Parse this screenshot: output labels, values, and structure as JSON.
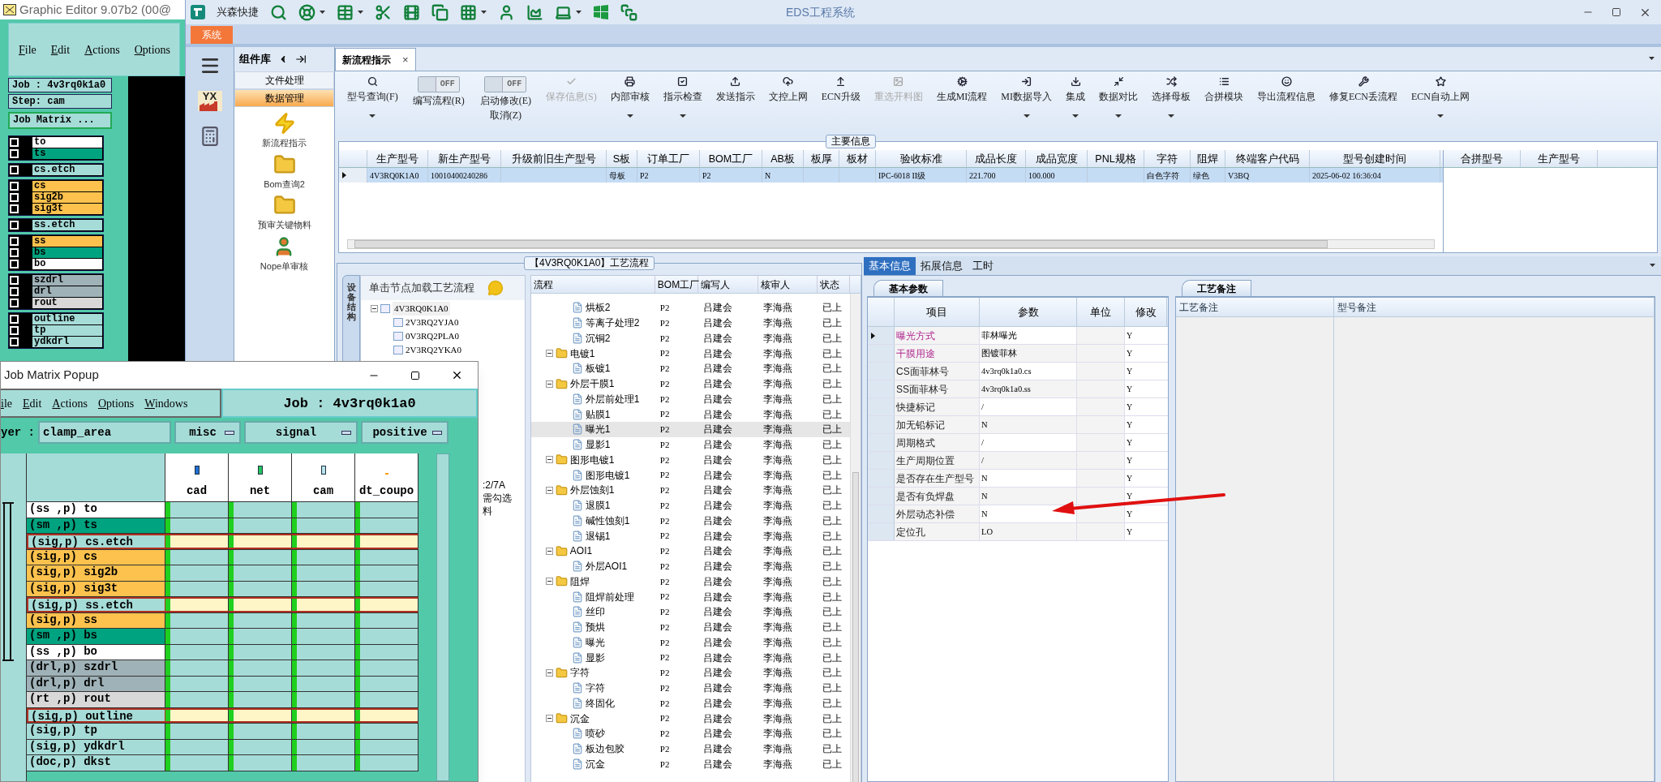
{
  "graphic_editor": {
    "title": "Graphic Editor 9.07b2 (00@",
    "menu": [
      "File",
      "Edit",
      "Actions",
      "Options"
    ],
    "job": "Job : 4v3rq0k1a0",
    "step": "Step: cam",
    "matrix_button": "Job Matrix ...",
    "layer_groups": [
      {
        "layers": [
          {
            "name": "to",
            "color": "#ffffff",
            "checked": false
          },
          {
            "name": "ts",
            "color": "#00a37f",
            "checked": false
          }
        ]
      },
      {
        "layers": [
          {
            "name": "cs.etch",
            "color": "#a6dcd8",
            "checked": false
          }
        ]
      },
      {
        "layers": [
          {
            "name": "cs",
            "color": "#fcc24d",
            "checked": false
          },
          {
            "name": "sig2b",
            "color": "#fcc24d",
            "checked": false
          },
          {
            "name": "sig3t",
            "color": "#fcc24d",
            "checked": false
          }
        ]
      },
      {
        "layers": [
          {
            "name": "ss.etch",
            "color": "#a6dcd8",
            "checked": false
          }
        ]
      },
      {
        "layers": [
          {
            "name": "ss",
            "color": "#fcc24d",
            "checked": false
          },
          {
            "name": "bs",
            "color": "#00a37f",
            "checked": false
          },
          {
            "name": "bo",
            "color": "#ffffff",
            "checked": false
          }
        ]
      },
      {
        "layers": [
          {
            "name": "szdrl",
            "color": "#9fb2b8",
            "checked": false
          },
          {
            "name": "drl",
            "color": "#9fb2b8",
            "checked": false
          },
          {
            "name": "rout",
            "color": "#d8d8d8",
            "checked": false
          }
        ]
      },
      {
        "layers": [
          {
            "name": "outline",
            "color": "#a6dcd8",
            "checked": false
          },
          {
            "name": "tp",
            "color": "#a6dcd8",
            "checked": false
          },
          {
            "name": "ydkdrl",
            "color": "#a6dcd8",
            "checked": false
          }
        ]
      }
    ]
  },
  "eds": {
    "brand": "兴森快捷",
    "title": "EDS工程系统",
    "side_logo": "YX",
    "ribbon_tabs": [
      {
        "label": "系统",
        "selected": true
      }
    ],
    "component_library": {
      "title": "组件库",
      "categories": [
        {
          "label": "文件处理",
          "selected": false
        },
        {
          "label": "数据管理",
          "selected": true
        }
      ],
      "items": [
        "新流程指示",
        "Bom查询2",
        "预审关键物料",
        "Nope单审核"
      ]
    },
    "doc_tabs": [
      {
        "label": "新流程指示",
        "selected": true,
        "close": "×"
      }
    ],
    "toolbar": [
      {
        "kind": "button",
        "label": "型号查询(F)",
        "disabled": false,
        "dropdown": true
      },
      {
        "kind": "switch",
        "label": "编写流程(R)",
        "switch_text": "OFF",
        "on": false
      },
      {
        "kind": "switch",
        "label": "启动修改(E)",
        "label2": "取消(Z)",
        "switch_text": "OFF",
        "on": false
      },
      {
        "kind": "button",
        "label": "保存信息(S)",
        "disabled": true,
        "dropdown": false
      },
      {
        "kind": "button",
        "label": "内部审核",
        "disabled": false,
        "dropdown": true
      },
      {
        "kind": "button",
        "label": "指示检查",
        "disabled": false,
        "dropdown": true
      },
      {
        "kind": "button",
        "label": "发送指示",
        "disabled": false,
        "dropdown": false
      },
      {
        "kind": "button",
        "label": "文控上网",
        "disabled": false,
        "dropdown": false
      },
      {
        "kind": "button",
        "label": "ECN升级",
        "disabled": false,
        "dropdown": false
      },
      {
        "kind": "button",
        "label": "重选开料图",
        "disabled": true,
        "dropdown": false
      },
      {
        "kind": "button",
        "label": "生成MI流程",
        "disabled": false,
        "dropdown": false
      },
      {
        "kind": "button",
        "label": "MI数据导入",
        "disabled": false,
        "dropdown": true
      },
      {
        "kind": "button",
        "label": "集成",
        "disabled": false,
        "dropdown": true
      },
      {
        "kind": "button",
        "label": "数据对比",
        "disabled": false,
        "dropdown": true
      },
      {
        "kind": "button",
        "label": "选择母板",
        "disabled": false,
        "dropdown": true
      },
      {
        "kind": "button",
        "label": "合拼模块",
        "disabled": false,
        "dropdown": false
      },
      {
        "kind": "button",
        "label": "导出流程信息",
        "disabled": false,
        "dropdown": false
      },
      {
        "kind": "button",
        "label": "修复ECN丢流程",
        "disabled": false,
        "dropdown": false
      },
      {
        "kind": "button",
        "label": "ECN自动上网",
        "disabled": false,
        "dropdown": true
      }
    ],
    "main_info": {
      "title": "主要信息",
      "columns": [
        "生产型号",
        "新生产型号",
        "升级前旧生产型号",
        "S板",
        "订单工厂",
        "BOM工厂",
        "AB板",
        "板厚",
        "板材",
        "验收标准",
        "成品长度",
        "成品宽度",
        "PNL规格",
        "字符",
        "阻焊",
        "终端客户代码",
        "型号创建时间"
      ],
      "rows": [
        {
          "current": true,
          "cells": [
            "4V3RQ0K1A0",
            "10010400240286",
            null,
            "母板",
            "P2",
            "P2",
            "N",
            null,
            null,
            "IPC-6018 II级",
            "221.700",
            "100.000",
            null,
            "白色字符",
            "绿色",
            "V3BQ",
            "2025-06-02 16:36:04"
          ]
        }
      ],
      "merge_columns": [
        "合拼型号",
        "生产型号"
      ]
    },
    "process": {
      "title": "【4V3RQ0K1A0】工艺流程",
      "side_tab": "设备结构",
      "hint": "单击节点加载工艺流程",
      "tree": {
        "label": "4V3RQ0K1A0",
        "children": [
          {
            "label": "2V3RQ2YJA0"
          },
          {
            "label": "0V3RQ2PLA0"
          },
          {
            "label": "2V3RQ2YKA0"
          }
        ]
      },
      "fragments": [
        ":2/7A",
        "需勾选",
        "料"
      ],
      "grid": {
        "columns": [
          "流程",
          "BOM工厂",
          "编写人",
          "核审人",
          "状态"
        ],
        "rows": [
          {
            "kind": "step",
            "name": "烘板2",
            "bom": "P2",
            "writer": "吕建会",
            "reviewer": "李海燕",
            "status": "已上",
            "selected": false
          },
          {
            "kind": "step",
            "name": "等离子处理2",
            "bom": "P2",
            "writer": "吕建会",
            "reviewer": "李海燕",
            "status": "已上",
            "selected": false
          },
          {
            "kind": "step",
            "name": "沉铜2",
            "bom": "P2",
            "writer": "吕建会",
            "reviewer": "李海燕",
            "status": "已上",
            "selected": false
          },
          {
            "kind": "folder",
            "name": "电镀1",
            "bom": "P2",
            "writer": "吕建会",
            "reviewer": "李海燕",
            "status": "已上",
            "selected": false,
            "expanded": true,
            "children": [
              {
                "kind": "step",
                "name": "板镀1",
                "bom": "P2",
                "writer": "吕建会",
                "reviewer": "李海燕",
                "status": "已上",
                "selected": false
              }
            ]
          },
          {
            "kind": "folder",
            "name": "外层干膜1",
            "bom": "P2",
            "writer": "吕建会",
            "reviewer": "李海燕",
            "status": "已上",
            "selected": false,
            "expanded": true,
            "children": [
              {
                "kind": "step",
                "name": "外层前处理1",
                "bom": "P2",
                "writer": "吕建会",
                "reviewer": "李海燕",
                "status": "已上",
                "selected": false
              },
              {
                "kind": "step",
                "name": "贴膜1",
                "bom": "P2",
                "writer": "吕建会",
                "reviewer": "李海燕",
                "status": "已上",
                "selected": false
              },
              {
                "kind": "step",
                "name": "曝光1",
                "bom": "P2",
                "writer": "吕建会",
                "reviewer": "李海燕",
                "status": "已上",
                "selected": true
              },
              {
                "kind": "step",
                "name": "显影1",
                "bom": "P2",
                "writer": "吕建会",
                "reviewer": "李海燕",
                "status": "已上",
                "selected": false
              }
            ]
          },
          {
            "kind": "folder",
            "name": "图形电镀1",
            "bom": "P2",
            "writer": "吕建会",
            "reviewer": "李海燕",
            "status": "已上",
            "selected": false,
            "expanded": true,
            "children": [
              {
                "kind": "step",
                "name": "图形电镀1",
                "bom": "P2",
                "writer": "吕建会",
                "reviewer": "李海燕",
                "status": "已上",
                "selected": false
              }
            ]
          },
          {
            "kind": "folder",
            "name": "外层蚀刻1",
            "bom": "P2",
            "writer": "吕建会",
            "reviewer": "李海燕",
            "status": "已上",
            "selected": false,
            "expanded": true,
            "children": [
              {
                "kind": "step",
                "name": "退膜1",
                "bom": "P2",
                "writer": "吕建会",
                "reviewer": "李海燕",
                "status": "已上",
                "selected": false
              },
              {
                "kind": "step",
                "name": "碱性蚀刻1",
                "bom": "P2",
                "writer": "吕建会",
                "reviewer": "李海燕",
                "status": "已上",
                "selected": false
              },
              {
                "kind": "step",
                "name": "退锡1",
                "bom": "P2",
                "writer": "吕建会",
                "reviewer": "李海燕",
                "status": "已上",
                "selected": false
              }
            ]
          },
          {
            "kind": "folder",
            "name": "AOI1",
            "bom": "P2",
            "writer": "吕建会",
            "reviewer": "李海燕",
            "status": "已上",
            "selected": false,
            "expanded": true,
            "children": [
              {
                "kind": "step",
                "name": "外层AOI1",
                "bom": "P2",
                "writer": "吕建会",
                "reviewer": "李海燕",
                "status": "已上",
                "selected": false
              }
            ]
          },
          {
            "kind": "folder",
            "name": "阻焊",
            "bom": "P2",
            "writer": "吕建会",
            "reviewer": "李海燕",
            "status": "已上",
            "selected": false,
            "expanded": true,
            "children": [
              {
                "kind": "step",
                "name": "阻焊前处理",
                "bom": "P2",
                "writer": "吕建会",
                "reviewer": "李海燕",
                "status": "已上",
                "selected": false
              },
              {
                "kind": "step",
                "name": "丝印",
                "bom": "P2",
                "writer": "吕建会",
                "reviewer": "李海燕",
                "status": "已上",
                "selected": false
              },
              {
                "kind": "step",
                "name": "预烘",
                "bom": "P2",
                "writer": "吕建会",
                "reviewer": "李海燕",
                "status": "已上",
                "selected": false
              },
              {
                "kind": "step",
                "name": "曝光",
                "bom": "P2",
                "writer": "吕建会",
                "reviewer": "李海燕",
                "status": "已上",
                "selected": false
              },
              {
                "kind": "step",
                "name": "显影",
                "bom": "P2",
                "writer": "吕建会",
                "reviewer": "李海燕",
                "status": "已上",
                "selected": false
              }
            ]
          },
          {
            "kind": "folder",
            "name": "字符",
            "bom": "P2",
            "writer": "吕建会",
            "reviewer": "李海燕",
            "status": "已上",
            "selected": false,
            "expanded": true,
            "children": [
              {
                "kind": "step",
                "name": "字符",
                "bom": "P2",
                "writer": "吕建会",
                "reviewer": "李海燕",
                "status": "已上",
                "selected": false
              },
              {
                "kind": "step",
                "name": "终固化",
                "bom": "P2",
                "writer": "吕建会",
                "reviewer": "李海燕",
                "status": "已上",
                "selected": false
              }
            ]
          },
          {
            "kind": "folder",
            "name": "沉金",
            "bom": "P2",
            "writer": "吕建会",
            "reviewer": "李海燕",
            "status": "已上",
            "selected": false,
            "expanded": true,
            "children": [
              {
                "kind": "step",
                "name": "喷砂",
                "bom": "P2",
                "writer": "吕建会",
                "reviewer": "李海燕",
                "status": "已上",
                "selected": false
              },
              {
                "kind": "step",
                "name": "板边包胶",
                "bom": "P2",
                "writer": "吕建会",
                "reviewer": "李海燕",
                "status": "已上",
                "selected": false
              },
              {
                "kind": "step",
                "name": "沉金",
                "bom": "P2",
                "writer": "吕建会",
                "reviewer": "李海燕",
                "status": "已上",
                "selected": false
              }
            ]
          }
        ]
      }
    },
    "detail": {
      "tabs": [
        {
          "label": "基本信息",
          "selected": true
        },
        {
          "label": "拓展信息",
          "selected": false
        },
        {
          "label": "工时",
          "selected": false
        }
      ],
      "params": {
        "tab": "基本参数",
        "columns": [
          "项目",
          "参数",
          "单位",
          "修改"
        ],
        "rows": [
          {
            "item": "曝光方式",
            "value": "菲林曝光",
            "modify": "Y",
            "required": true,
            "current": true
          },
          {
            "item": "干膜用途",
            "value": "图镀菲林",
            "modify": "Y",
            "required": true,
            "current": false
          },
          {
            "item": "CS面菲林号",
            "value": "4v3rq0k1a0.cs",
            "modify": "Y",
            "required": false,
            "current": false
          },
          {
            "item": "SS面菲林号",
            "value": "4v3rq0k1a0.ss",
            "modify": "Y",
            "required": false,
            "current": false
          },
          {
            "item": "快捷标记",
            "value": "/",
            "modify": "Y",
            "required": false,
            "current": false
          },
          {
            "item": "加无铅标记",
            "value": "N",
            "modify": "Y",
            "required": false,
            "current": false
          },
          {
            "item": "周期格式",
            "value": "/",
            "modify": "Y",
            "required": false,
            "current": false
          },
          {
            "item": "生产周期位置",
            "value": "/",
            "modify": "Y",
            "required": false,
            "current": false
          },
          {
            "item": "是否存在生产型号",
            "value": "N",
            "modify": "Y",
            "required": false,
            "current": false
          },
          {
            "item": "是否有负焊盘",
            "value": "N",
            "modify": "Y",
            "required": false,
            "current": false
          },
          {
            "item": "外层动态补偿",
            "value": "N",
            "modify": "Y",
            "required": false,
            "current": false
          },
          {
            "item": "定位孔",
            "value": "LO",
            "modify": "Y",
            "required": false,
            "current": false
          }
        ]
      },
      "notes": {
        "tab": "工艺备注",
        "columns": [
          "工艺备注",
          "型号备注"
        ]
      }
    }
  },
  "job_matrix_popup": {
    "title": "Job Matrix Popup",
    "menu": [
      "ile",
      "Edit",
      "Actions",
      "Options",
      "Windows"
    ],
    "job": "Job : 4v3rq0k1a0",
    "layer_label": "yer :",
    "layer_value": "clamp_area",
    "selects": [
      "misc",
      "signal",
      "positive"
    ],
    "columns": [
      {
        "name": "cad",
        "color": "#1f6fd1"
      },
      {
        "name": "net",
        "color": "#22c55e"
      },
      {
        "name": "cam",
        "color": "#b9e3ec"
      },
      {
        "name": "dt_coupo",
        "color": "#f59e0b"
      }
    ],
    "rows": [
      {
        "label": "(ss ,p) to",
        "color": "#ffffff",
        "highlighted": false
      },
      {
        "label": "(sm ,p) ts",
        "color": "#00a37f",
        "highlighted": false
      },
      {
        "label": "(sig,p) cs.etch",
        "color": "#a6dcd8",
        "highlighted": true
      },
      {
        "label": "(sig,p) cs",
        "color": "#fcc24d",
        "highlighted": false
      },
      {
        "label": "(sig,p) sig2b",
        "color": "#fcc24d",
        "highlighted": false
      },
      {
        "label": "(sig,p) sig3t",
        "color": "#fcc24d",
        "highlighted": false
      },
      {
        "label": "(sig,p) ss.etch",
        "color": "#a6dcd8",
        "highlighted": true
      },
      {
        "label": "(sig,p) ss",
        "color": "#fcc24d",
        "highlighted": false
      },
      {
        "label": "(sm ,p) bs",
        "color": "#00a37f",
        "highlighted": false
      },
      {
        "label": "(ss ,p) bo",
        "color": "#ffffff",
        "highlighted": false
      },
      {
        "label": "(drl,p) szdrl",
        "color": "#9fb2b8",
        "highlighted": false
      },
      {
        "label": "(drl,p) drl",
        "color": "#9fb2b8",
        "highlighted": false
      },
      {
        "label": "(rt ,p) rout",
        "color": "#d8d8d8",
        "highlighted": false
      },
      {
        "label": "(sig,p) outline",
        "color": "#a6dcd8",
        "highlighted": true
      },
      {
        "label": "(sig,p) tp",
        "color": "#a6dcd8",
        "highlighted": false
      },
      {
        "label": "(sig,p) ydkdrl",
        "color": "#a6dcd8",
        "highlighted": false
      },
      {
        "label": "(doc,p) dkst",
        "color": "#a6dcd8",
        "highlighted": false
      }
    ]
  }
}
